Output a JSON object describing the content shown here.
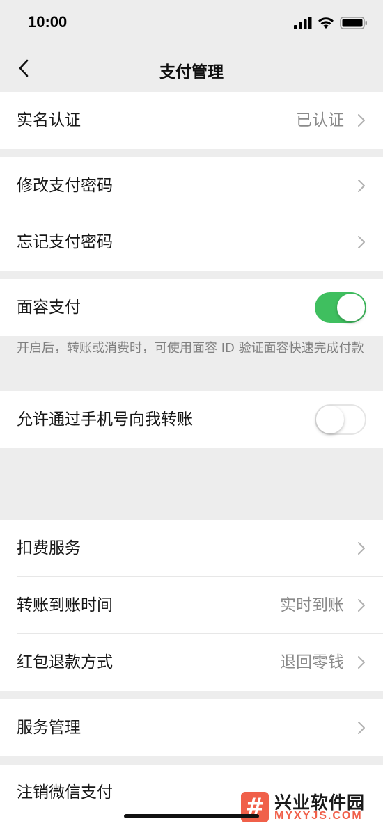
{
  "status_bar": {
    "time": "10:00",
    "icons": [
      "signal-icon",
      "wifi-icon",
      "battery-icon"
    ]
  },
  "nav": {
    "title": "支付管理",
    "back_icon": "chevron-left-icon"
  },
  "sections": {
    "identity": {
      "label": "实名认证",
      "value": "已认证"
    },
    "change_password": {
      "label": "修改支付密码"
    },
    "forgot_password": {
      "label": "忘记支付密码"
    },
    "face_pay": {
      "label": "面容支付",
      "enabled": true,
      "hint": "开启后，转账或消费时，可使用面容 ID 验证面容快速完成付款"
    },
    "phone_transfer": {
      "label": "允许通过手机号向我转账",
      "enabled": false
    },
    "deduction": {
      "label": "扣费服务"
    },
    "transfer_time": {
      "label": "转账到账时间",
      "value": "实时到账"
    },
    "red_packet_refund": {
      "label": "红包退款方式",
      "value": "退回零钱"
    },
    "service_management": {
      "label": "服务管理"
    },
    "cancel_wechat_pay": {
      "label": "注销微信支付"
    }
  },
  "watermark": {
    "logo": "#",
    "name": "兴业软件园",
    "url": "MYXYJS.COM"
  },
  "colors": {
    "background": "#ededed",
    "toggle_on": "#3fbf5f",
    "secondary_text": "#8a8a8a",
    "watermark_accent": "#f0604a"
  }
}
